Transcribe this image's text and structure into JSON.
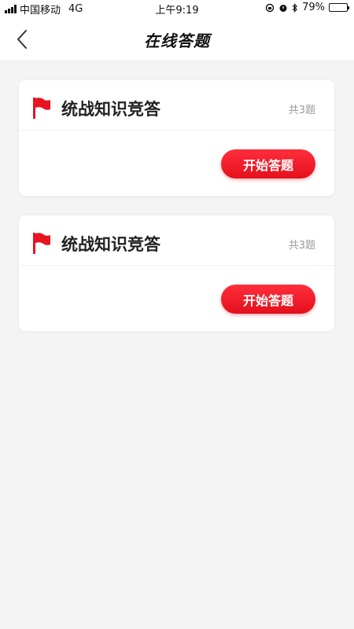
{
  "status_bar": {
    "carrier": "中国移动",
    "network": "4G",
    "time": "上午9:19",
    "battery_text": "79%",
    "battery_level": 0.79
  },
  "header": {
    "title": "在线答题",
    "back_icon": "chevron-left-icon"
  },
  "quizzes": [
    {
      "title": "统战知识竞答",
      "count": "共3题",
      "button_label": "开始答题",
      "icon": "red-flag-icon"
    },
    {
      "title": "统战知识竞答",
      "count": "共3题",
      "button_label": "开始答题",
      "icon": "red-flag-icon"
    }
  ],
  "colors": {
    "accent": "#e8141f",
    "background": "#f4f4f4",
    "card": "#ffffff"
  }
}
